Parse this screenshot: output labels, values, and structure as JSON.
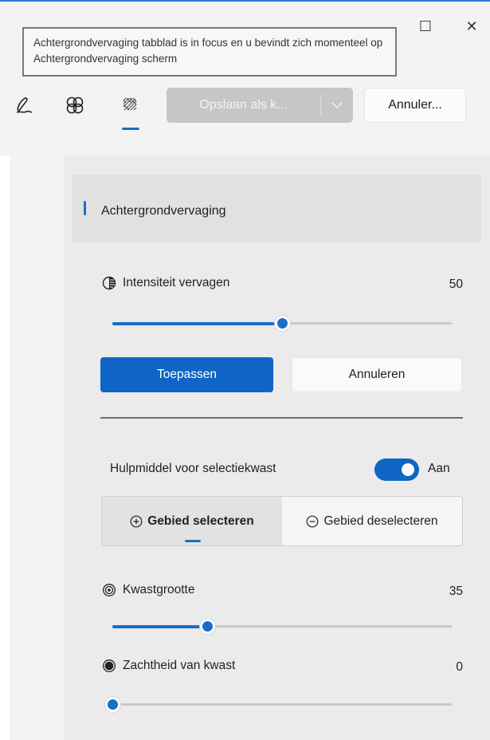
{
  "window": {
    "maximize_glyph": "☐",
    "close_glyph": "✕"
  },
  "tooltip": {
    "text": "Achtergrondvervaging tabblad is in focus en u bevindt zich momenteel op Achtergrondvervaging scherm"
  },
  "toolbar": {
    "icons": [
      "markup-pen-icon",
      "filter-icon",
      "background-blur-icon"
    ],
    "save_label": "Opslaan als k...",
    "cancel_label": "Annuler..."
  },
  "section": {
    "title": "Achtergrondvervaging"
  },
  "blur_intensity": {
    "label": "Intensiteit vervagen",
    "value": "50",
    "fraction": 0.5
  },
  "actions": {
    "apply_label": "Toepassen",
    "cancel_label": "Annuleren"
  },
  "brush_helper": {
    "label": "Hulpmiddel voor selectiekwast",
    "state": "Aan",
    "enabled": true
  },
  "selection_mode": {
    "select_label": "Gebied selecteren",
    "deselect_label": "Gebied deselecteren",
    "active": "select"
  },
  "brush_size": {
    "label": "Kwastgrootte",
    "value": "35",
    "fraction": 0.28
  },
  "brush_softness": {
    "label": "Zachtheid van kwast",
    "value": "0",
    "fraction": 0.0
  },
  "colors": {
    "accent": "#0f65c5",
    "background": "#f3f3f3",
    "panel": "#ebebeb"
  }
}
